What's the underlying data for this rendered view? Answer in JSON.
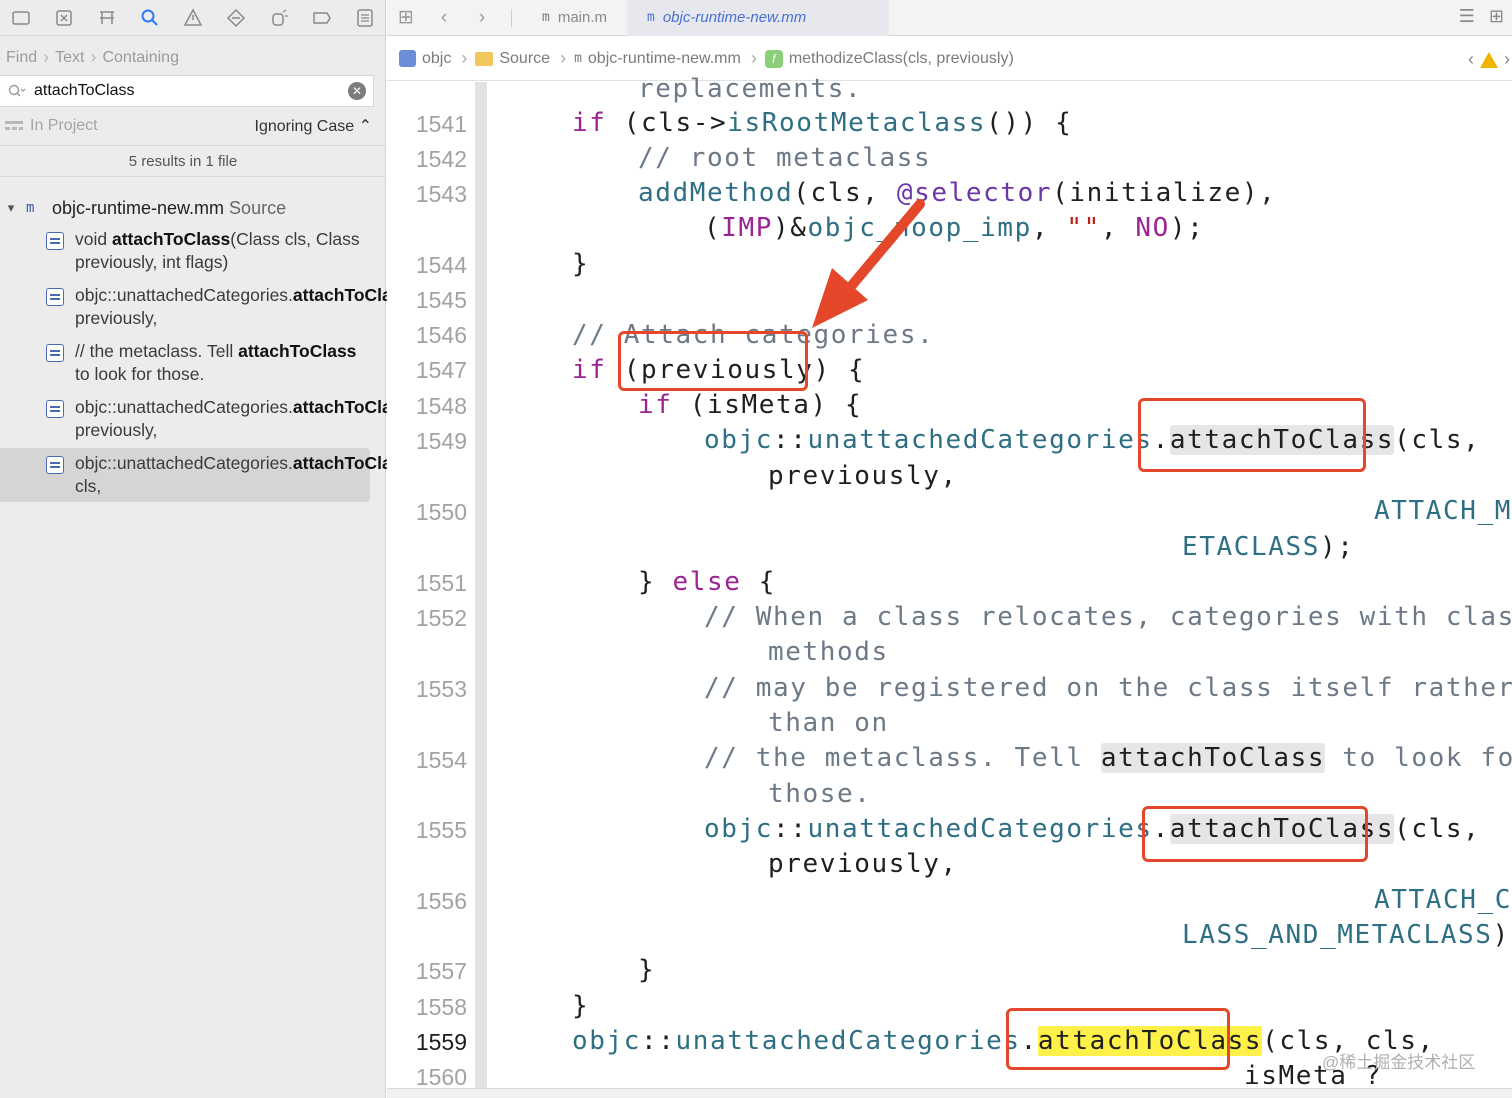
{
  "nav_icons": [
    "folder-icon",
    "source-control-icon",
    "hierarchy-icon",
    "search-icon",
    "warning-icon",
    "test-icon",
    "debug-icon",
    "breakpoint-icon",
    "report-icon"
  ],
  "find": {
    "path": [
      "Find",
      "Text",
      "Containing"
    ],
    "query": "attachToClass",
    "scope": "In Project",
    "case_mode": "Ignoring Case ⌃",
    "results_summary": "5 results in 1 file"
  },
  "file_group": {
    "name": "objc-runtime-new.mm",
    "source": "Source"
  },
  "results": [
    {
      "pre": "void ",
      "match": "attachToClass",
      "post": "(Class cls, Class previously, int flags)"
    },
    {
      "pre": "objc::unattachedCategories.",
      "match": "attachToClass",
      "post": "(cls, previously,"
    },
    {
      "pre": "// the metaclass. Tell ",
      "match": "attachToClass",
      "post": " to look for those."
    },
    {
      "pre": "objc::unattachedCategories.",
      "match": "attachToClass",
      "post": "(cls, previously,"
    },
    {
      "pre": "objc::unattachedCategories.",
      "match": "attachToClass",
      "post": "(cls, cls,"
    }
  ],
  "tabs": [
    {
      "label": "main.m",
      "badge": "m"
    },
    {
      "label": "objc-runtime-new.mm",
      "badge": "m"
    }
  ],
  "breadcrumb": [
    "objc",
    "Source",
    "objc-runtime-new.mm",
    "methodizeClass(cls, previously)"
  ],
  "line_numbers": [
    "1541",
    "1542",
    "1543",
    "1544",
    "1545",
    "1546",
    "1547",
    "1548",
    "1549",
    "1550",
    "1551",
    "1552",
    "1553",
    "1554",
    "1555",
    "1556",
    "1557",
    "1558",
    "1559",
    "1560"
  ],
  "code": {
    "l0": "replacements.",
    "l1541": "if (cls->isRootMetaclass()) {",
    "l1542": "// root metaclass",
    "l1543a": "addMethod(cls, @selector(initialize),",
    "l1543b": "(IMP)&objc_noop_imp, \"\", NO);",
    "l1544": "}",
    "l1546": "// Attach categories.",
    "l1547": "if (previously) {",
    "l1548": "if (isMeta) {",
    "l1549a": "objc::unattachedCategories.attachToClass(cls,",
    "l1549b": "previously,",
    "l1550a": "ATTACH_M",
    "l1550b": "ETACLASS);",
    "l1551": "} else {",
    "l1552a": "// When a class relocates, categories with class",
    "l1552b": "methods",
    "l1553a": "// may be registered on the class itself rather",
    "l1553b": "than on",
    "l1554a": "// the metaclass. Tell attachToClass to look for",
    "l1554b": "those.",
    "l1555a": "objc::unattachedCategories.attachToClass(cls,",
    "l1555b": "previously,",
    "l1556a": "ATTACH_C",
    "l1556b": "LASS_AND_METACLASS);",
    "l1557": "}",
    "l1558": "}",
    "l1559a": "objc::unattachedCategories.attachToClass(cls, cls,",
    "l1559b": "isMeta ?"
  },
  "watermark": "@稀土掘金技术社区",
  "colors": {
    "keyword": "#9b2393",
    "function": "#2f6f84",
    "comment": "#6c7986",
    "annotation_red": "#e4472a",
    "match_yellow": "#fff04a",
    "accent_blue": "#2b7cf3"
  }
}
